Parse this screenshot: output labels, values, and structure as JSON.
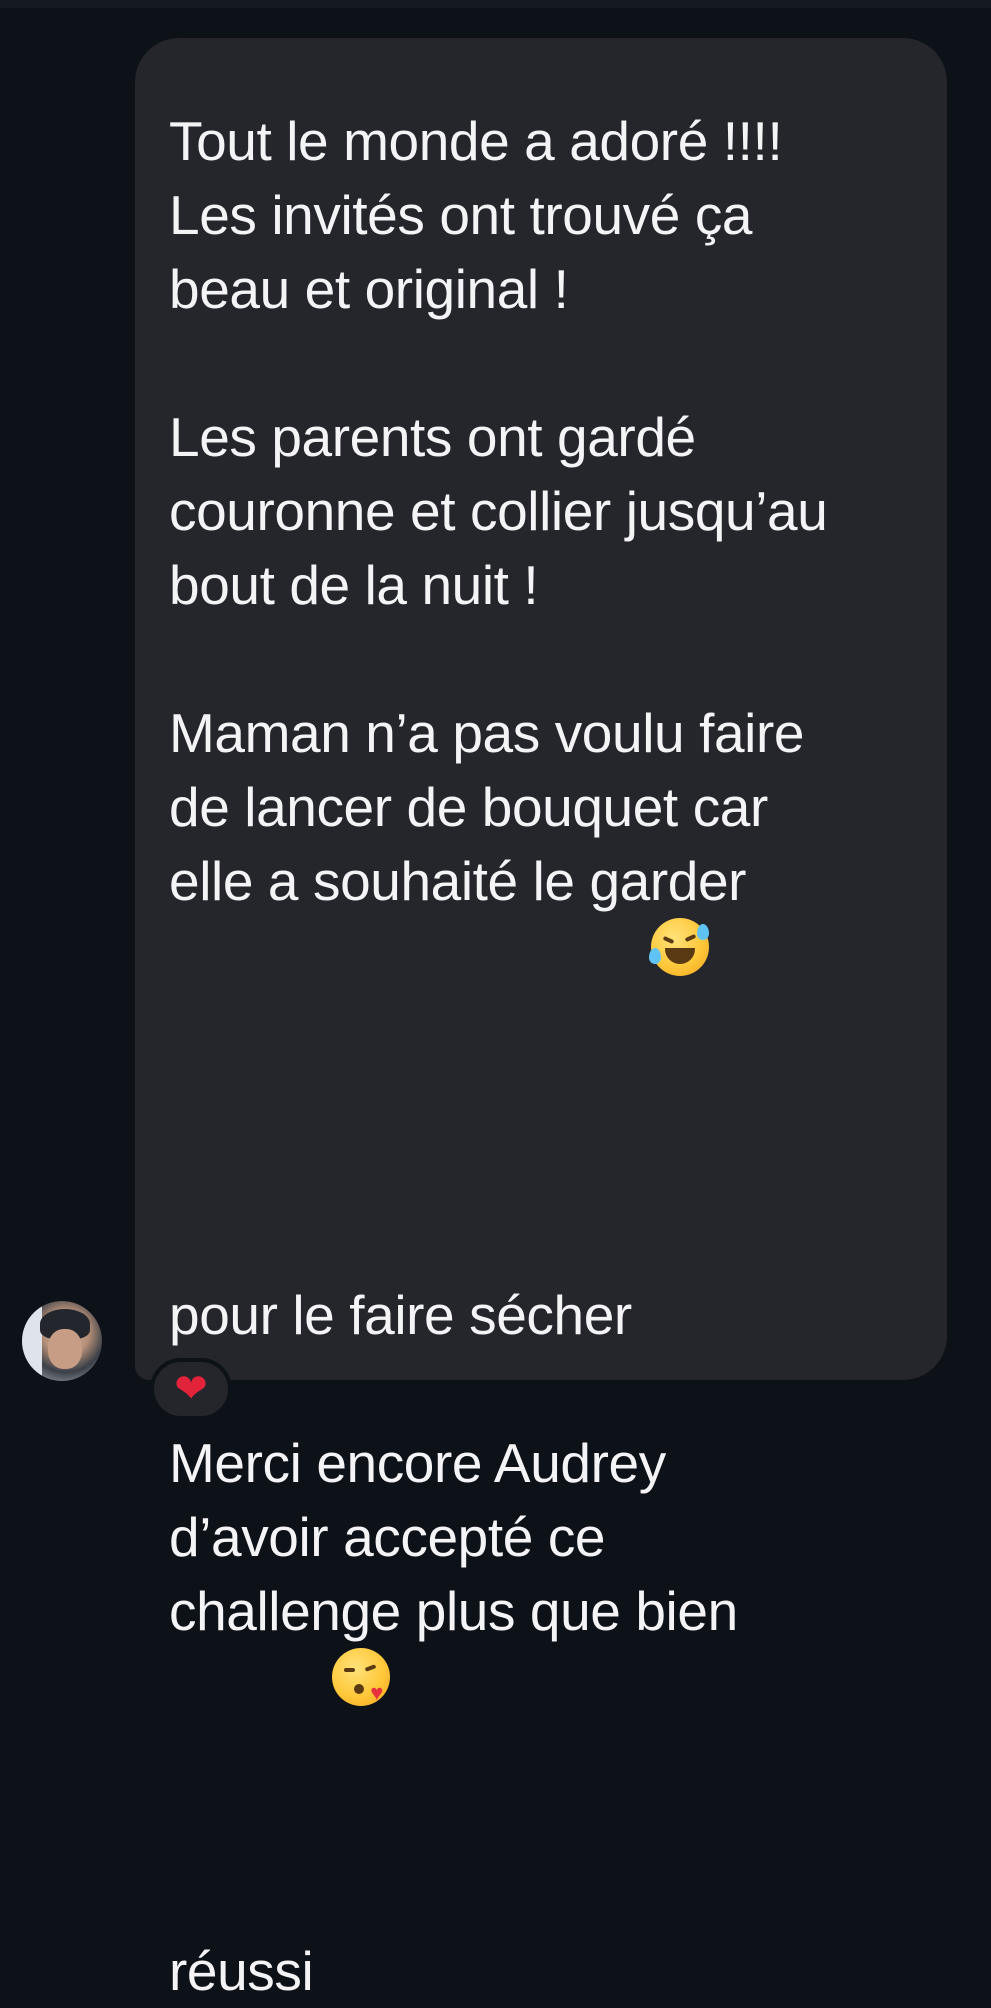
{
  "message": {
    "paragraphs": [
      "Tout le monde a adoré !!!!\nLes invités ont trouvé ça\nbeau et original !",
      "Les parents ont gardé\ncouronne et collier jusqu’au\nbout de la nuit !",
      "Maman n’a pas voulu faire\nde lancer de bouquet car\nelle a souhaité le garder\npour le faire sécher",
      "Merci encore Audrey\nd’avoir accepté ce\nchallenge plus que bien\nréussi"
    ],
    "emojis": [
      "rolling-on-floor-laughing-icon",
      "face-blowing-kiss-icon"
    ]
  },
  "reaction": {
    "icon": "heart-icon",
    "symbol": "❤"
  },
  "colors": {
    "background": "#0d1118",
    "bubble": "#24262c",
    "text": "#f4f4f6",
    "heart": "#e2233a"
  }
}
